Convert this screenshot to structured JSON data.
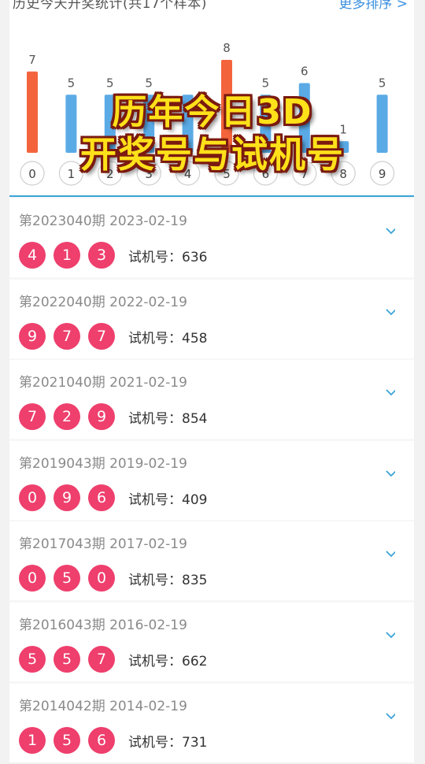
{
  "header": {
    "title": "历史今天开奖统计(共17个样本)",
    "more_label": "更多排序 >"
  },
  "overlay": {
    "line1": "历年今日3D",
    "line2": "开奖号与试机号"
  },
  "chart_data": {
    "type": "bar",
    "categories": [
      "0",
      "1",
      "2",
      "3",
      "4",
      "5",
      "6",
      "7",
      "8",
      "9"
    ],
    "values": [
      7,
      5,
      5,
      5,
      5,
      8,
      5,
      6,
      1,
      5
    ],
    "value_labels": [
      "7",
      "5",
      "5",
      "5",
      "",
      "8",
      "5",
      "6",
      "1",
      "5"
    ],
    "bar_colors": [
      "#f4643c",
      "#5aaae6",
      "#5aaae6",
      "#5aaae6",
      "#5aaae6",
      "#f4643c",
      "#5aaae6",
      "#5aaae6",
      "#5aaae6",
      "#5aaae6"
    ],
    "ylim": [
      0,
      8
    ],
    "title": "",
    "xlabel": "",
    "ylabel": ""
  },
  "draws": [
    {
      "meta": "第2023040期 2023-02-19",
      "balls": [
        "4",
        "1",
        "3"
      ],
      "trial": "试机号：636"
    },
    {
      "meta": "第2022040期 2022-02-19",
      "balls": [
        "9",
        "7",
        "7"
      ],
      "trial": "试机号：458"
    },
    {
      "meta": "第2021040期 2021-02-19",
      "balls": [
        "7",
        "2",
        "9"
      ],
      "trial": "试机号：854"
    },
    {
      "meta": "第2019043期 2019-02-19",
      "balls": [
        "0",
        "9",
        "6"
      ],
      "trial": "试机号：409"
    },
    {
      "meta": "第2017043期 2017-02-19",
      "balls": [
        "0",
        "5",
        "0"
      ],
      "trial": "试机号：835"
    },
    {
      "meta": "第2016043期 2016-02-19",
      "balls": [
        "5",
        "5",
        "7"
      ],
      "trial": "试机号：662"
    },
    {
      "meta": "第2014042期 2014-02-19",
      "balls": [
        "1",
        "5",
        "6"
      ],
      "trial": "试机号：731"
    }
  ],
  "colors": {
    "ball": "#ee3f6d",
    "accent": "#3aa4d8"
  }
}
